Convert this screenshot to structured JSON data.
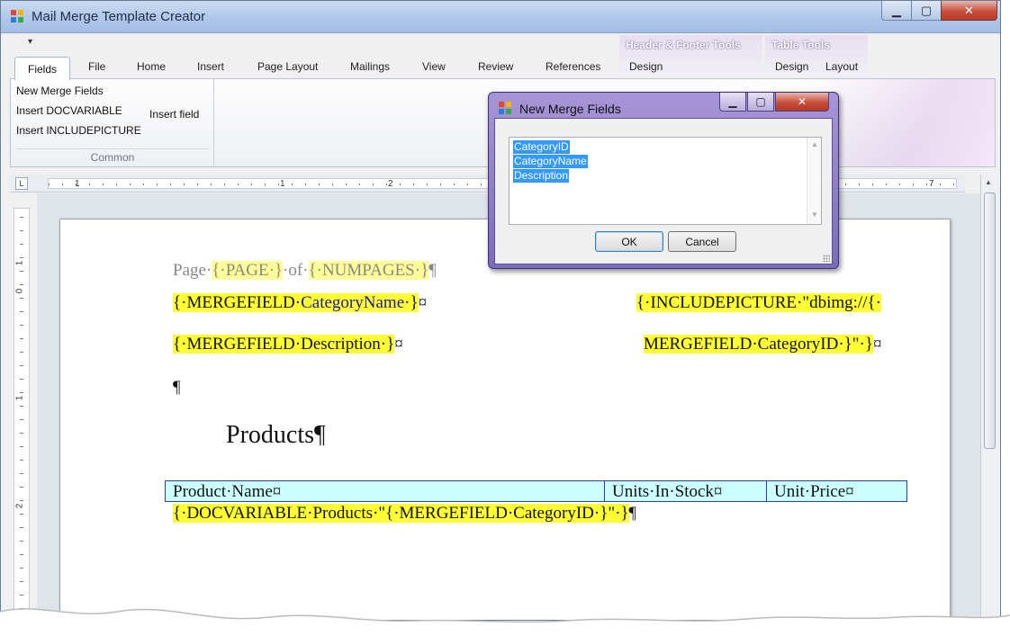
{
  "window": {
    "title": "Mail Merge Template Creator",
    "min_glyph": "▁",
    "max_glyph": "▢",
    "close_glyph": "✕"
  },
  "qat": {
    "arrow": "▾"
  },
  "context_groups": {
    "header_footer": "Header & Footer Tools",
    "table": "Table Tools"
  },
  "tabs": {
    "fields": "Fields",
    "file": "File",
    "home": "Home",
    "insert": "Insert",
    "page_layout": "Page Layout",
    "mailings": "Mailings",
    "view": "View",
    "review": "Review",
    "references": "References",
    "hf_design": "Design",
    "tt_design": "Design",
    "tt_layout": "Layout"
  },
  "ribbon": {
    "new_merge_fields": "New Merge Fields",
    "insert_docvariable": "Insert DOCVARIABLE",
    "insert_includepicture": "Insert INCLUDEPICTURE",
    "insert_field": "Insert field",
    "group_common": "Common"
  },
  "ruler": {
    "corner": "L",
    "numbers": [
      "1",
      "1",
      "2",
      "7"
    ]
  },
  "vruler": {
    "numbers": [
      "1",
      "0",
      "1",
      "2"
    ]
  },
  "document": {
    "page_prefix": "Page·",
    "page_field": "{·PAGE·}",
    "of_text": "·of·",
    "numpages_field": "{·NUMPAGES·}",
    "pilcrow": "¶",
    "merge_category_open": "{·MERGEFIELD·",
    "merge_category_name": "CategoryName",
    "merge_category_close": "·}",
    "cell_mark": "¤",
    "merge_description": "{·MERGEFIELD·Description·}",
    "include_picture_1": "{·INCLUDEPICTURE·\"dbimg://{·",
    "include_picture_2": "MERGEFIELD·CategoryID·}\"·}",
    "empty_para": "¶",
    "products_title": "Products¶",
    "table_headers": [
      "Product·Name¤",
      "Units·In·Stock¤",
      "Unit·Price¤"
    ],
    "docvariable": "{·DOCVARIABLE·Products·\"{·MERGEFIELD·CategoryID·}\"·}"
  },
  "dialog": {
    "title": "New Merge Fields",
    "items": [
      "CategoryID",
      "CategoryName",
      "Description"
    ],
    "ok": "OK",
    "cancel": "Cancel",
    "up_arrow": "▲",
    "down_arrow": "▼"
  },
  "colors": {
    "field_highlight": "#ffff33",
    "table_fill": "#ccffff",
    "selection": "#3399ff",
    "dialog_frame": "#8f7fcc"
  }
}
